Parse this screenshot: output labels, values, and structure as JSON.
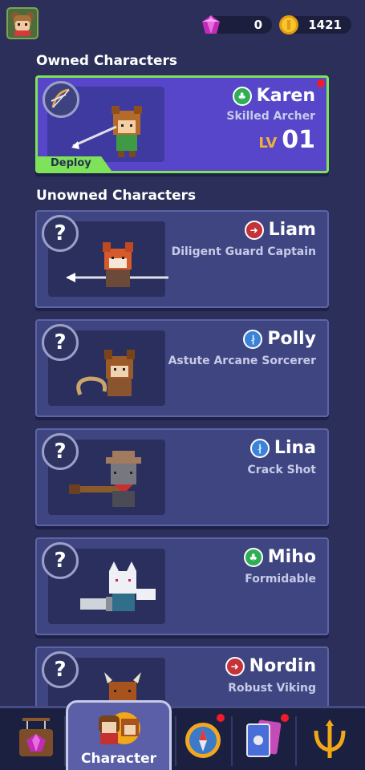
{
  "currency": {
    "gems": "0",
    "gold": "1421"
  },
  "sections": {
    "owned_title": "Owned Characters",
    "unowned_title": "Unowned Characters"
  },
  "owned": [
    {
      "name": "Karen",
      "subtitle": "Skilled Archer",
      "class_icon": "nature-class-icon",
      "class_color": "#2fae55",
      "level_label": "LV",
      "level": "01",
      "deploy_label": "Deploy"
    }
  ],
  "unowned": [
    {
      "name": "Liam",
      "subtitle": "Diligent Guard Captain",
      "class_icon": "shield-class-icon",
      "class_color": "#c43339"
    },
    {
      "name": "Polly",
      "subtitle": "Astute Arcane Sorcerer",
      "class_icon": "magic-class-icon",
      "class_color": "#3a83d8"
    },
    {
      "name": "Lina",
      "subtitle": "Crack Shot",
      "class_icon": "magic-class-icon",
      "class_color": "#3a83d8"
    },
    {
      "name": "Miho",
      "subtitle": "Formidable",
      "class_icon": "nature-class-icon",
      "class_color": "#2fae55"
    },
    {
      "name": "Nordin",
      "subtitle": "Robust Viking",
      "class_icon": "shield-class-icon",
      "class_color": "#c43339"
    }
  ],
  "unowned_badge": "?",
  "nav": {
    "active_label": "Character"
  },
  "colors": {
    "background": "#2b2f59",
    "owned_border": "#7fe35a",
    "owned_fill": "#5746c9",
    "level_accent": "#f0b03a",
    "notification": "#f01c2c"
  }
}
